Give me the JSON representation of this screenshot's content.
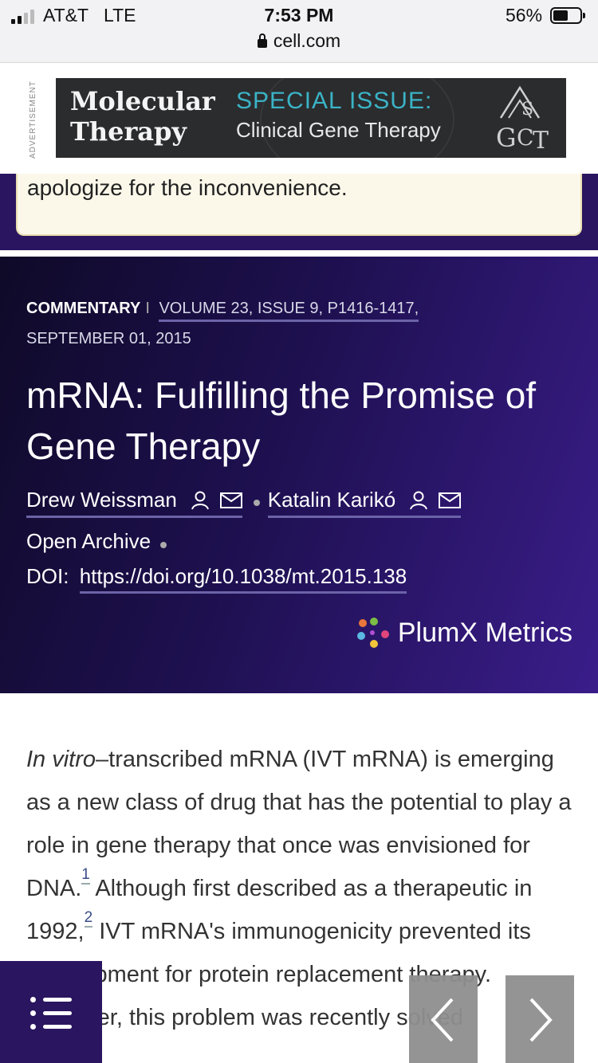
{
  "status_bar": {
    "carrier": "AT&T",
    "network": "LTE",
    "time": "7:53 PM",
    "battery_percent": "56%",
    "battery_level": 0.56,
    "url": "cell.com"
  },
  "ad": {
    "vertical_label": "ADVERTISEMENT",
    "title_line1": "Molecular",
    "title_line2": "Therapy",
    "special": "SPECIAL ISSUE:",
    "subtitle": "Clinical Gene Therapy",
    "logo_text": "ASGCT"
  },
  "notice": {
    "text": "apologize for the inconvenience."
  },
  "article": {
    "type": "COMMENTARY",
    "volume": "VOLUME 23, ISSUE 9, P1416-1417,",
    "date": "SEPTEMBER 01, 2015",
    "title": "mRNA: Fulfilling the Promise of Gene Therapy",
    "authors": [
      "Drew Weissman",
      "Katalin Karikó"
    ],
    "access": "Open Archive",
    "doi_label": "DOI:",
    "doi_url": "https://doi.org/10.1038/mt.2015.138",
    "plumx": "PlumX Metrics"
  },
  "body": {
    "italic_lead": "In vitro",
    "p1": "–transcribed mRNA (IVT mRNA) is emerging as a new class of drug that has the potential to play a role in gene therapy that once was envisioned for DNA.",
    "ref1": "1",
    "p2": " Although first described as a therapeutic in 1992,",
    "ref2": "2",
    "p3": " IVT mRNA's immunogenicity prevented its development for protein replacement therapy. However, this problem was recently solved"
  }
}
